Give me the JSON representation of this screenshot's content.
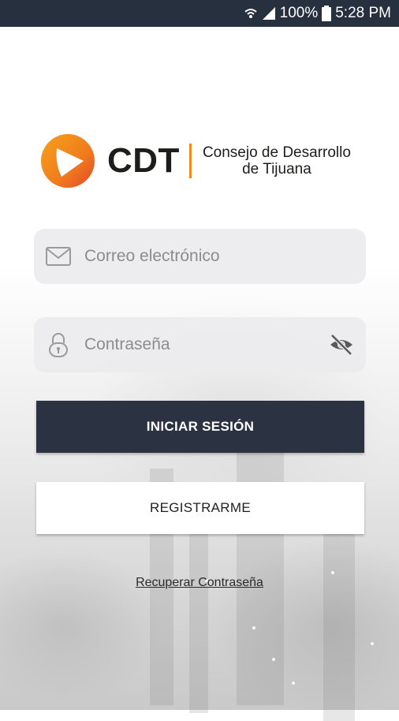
{
  "status_bar": {
    "battery": "100%",
    "time": "5:28 PM",
    "icons": [
      "wifi-icon",
      "signal-icon",
      "battery-icon"
    ]
  },
  "brand": {
    "short_name": "CDT",
    "full_name_line1": "Consejo de Desarrollo",
    "full_name_line2": "de Tijuana",
    "accent_color": "#f08a1c",
    "accent_color_2": "#e2452a"
  },
  "form": {
    "email": {
      "placeholder": "Correo electrónico",
      "value": "",
      "icon": "mail-icon"
    },
    "password": {
      "placeholder": "Contraseña",
      "value": "",
      "icon": "lock-icon",
      "toggle_icon": "eye-off-icon"
    }
  },
  "actions": {
    "login_label": "INICIAR SESIÓN",
    "register_label": "REGISTRARME",
    "recover_label": "Recuperar Contraseña"
  },
  "colors": {
    "status_bar": "#27303e",
    "primary_button": "#2b3342"
  }
}
